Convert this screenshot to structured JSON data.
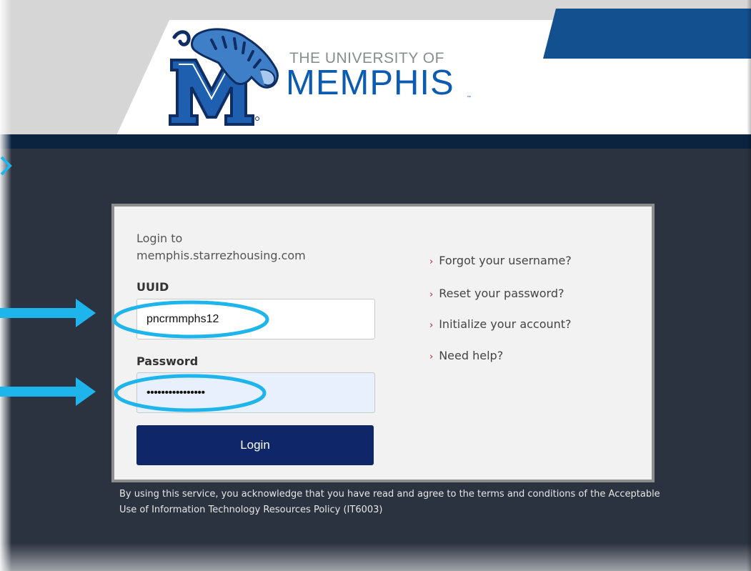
{
  "logo": {
    "line1": "THE UNIVERSITY OF",
    "line2": "MEMPHIS",
    "tm": "™"
  },
  "login": {
    "heading_line1": "Login to",
    "heading_line2": "memphis.starrezhousing.com",
    "uuid_label": "UUID",
    "uuid_value": "pncrmmphs12",
    "password_label": "Password",
    "password_value": "••••••••••••••••",
    "submit_label": "Login"
  },
  "links": [
    {
      "label": "Forgot your username?"
    },
    {
      "label": "Reset your password?"
    },
    {
      "label": "Initialize your account?"
    },
    {
      "label": "Need help?"
    }
  ],
  "link_chevron": "›",
  "policy_text": "By using this service, you acknowledge that you have read and agree to the terms and conditions of the Acceptable Use of Information Technology Resources Policy (IT6003)",
  "colors": {
    "brand_blue": "#0b5bb0",
    "navy": "#0c2340",
    "button": "#0f2768",
    "annotation": "#1eb4ec",
    "link_chevron": "#b0222a"
  },
  "icons": {
    "logo_mark": "tiger-m-logo",
    "annotation_arrow": "right-arrow-icon",
    "annotation_ellipse": "highlight-ellipse"
  }
}
